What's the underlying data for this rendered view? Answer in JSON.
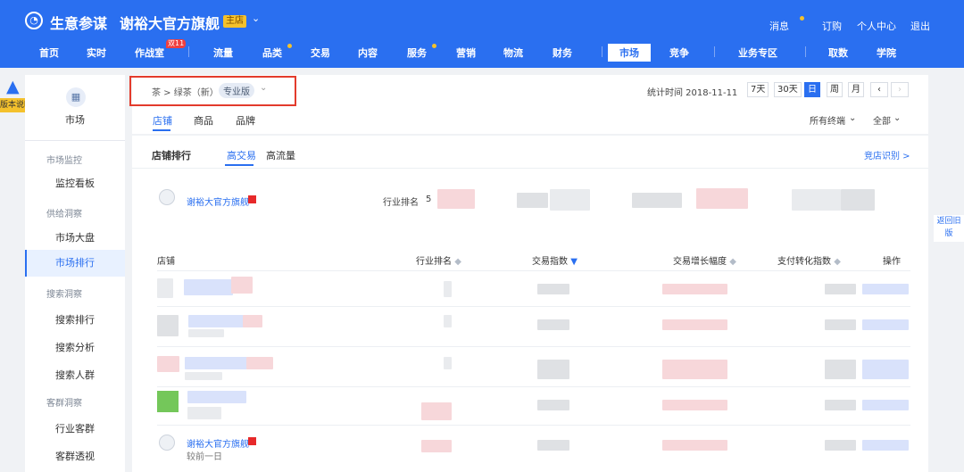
{
  "top": {
    "brand": "生意参谋",
    "store": "谢裕大官方旗舰",
    "badge": "主店",
    "right": [
      "消息",
      "订购",
      "个人中心",
      "退出"
    ]
  },
  "nav": [
    {
      "label": "首页"
    },
    {
      "label": "实时"
    },
    {
      "label": "作战室"
    },
    {
      "label": "流量"
    },
    {
      "label": "品类"
    },
    {
      "label": "交易"
    },
    {
      "label": "内容"
    },
    {
      "label": "服务"
    },
    {
      "label": "营销"
    },
    {
      "label": "物流"
    },
    {
      "label": "财务"
    },
    {
      "label": "市场"
    },
    {
      "label": "竞争"
    },
    {
      "label": "业务专区"
    },
    {
      "label": "取数"
    },
    {
      "label": "学院"
    }
  ],
  "nav_hot": "双11",
  "side": {
    "title": "市场",
    "groups": [
      {
        "label": "市场监控",
        "items": [
          "监控看板"
        ]
      },
      {
        "label": "供给洞察",
        "items": [
          "市场大盘",
          "市场排行"
        ]
      },
      {
        "label": "搜索洞察",
        "items": [
          "搜索排行",
          "搜索分析",
          "搜索人群"
        ]
      },
      {
        "label": "客群洞察",
        "items": [
          "行业客群",
          "客群透视"
        ]
      }
    ]
  },
  "help": "版本说明",
  "old": "返回旧版",
  "breadcrumb": "茶 > 绿茶（新）",
  "version": "专业版",
  "stat": {
    "label": "统计时间 2018-11-11",
    "ranges": [
      "7天",
      "30天",
      "日",
      "周",
      "月"
    ]
  },
  "subtabs": [
    "店铺",
    "商品",
    "品牌"
  ],
  "filters": [
    "所有终端",
    "全部"
  ],
  "ranking": {
    "title": "店铺排行",
    "tabs": [
      "高交易",
      "高流量"
    ],
    "compare": "竞店识别 >",
    "shop_name": "谢裕大官方旗舰",
    "rank_label": "行业排名",
    "rank_value": "5",
    "headers": [
      "店铺",
      "行业排名",
      "交易指数",
      "交易增长幅度",
      "支付转化指数",
      "操作"
    ],
    "bottom_note": "较前一日"
  }
}
